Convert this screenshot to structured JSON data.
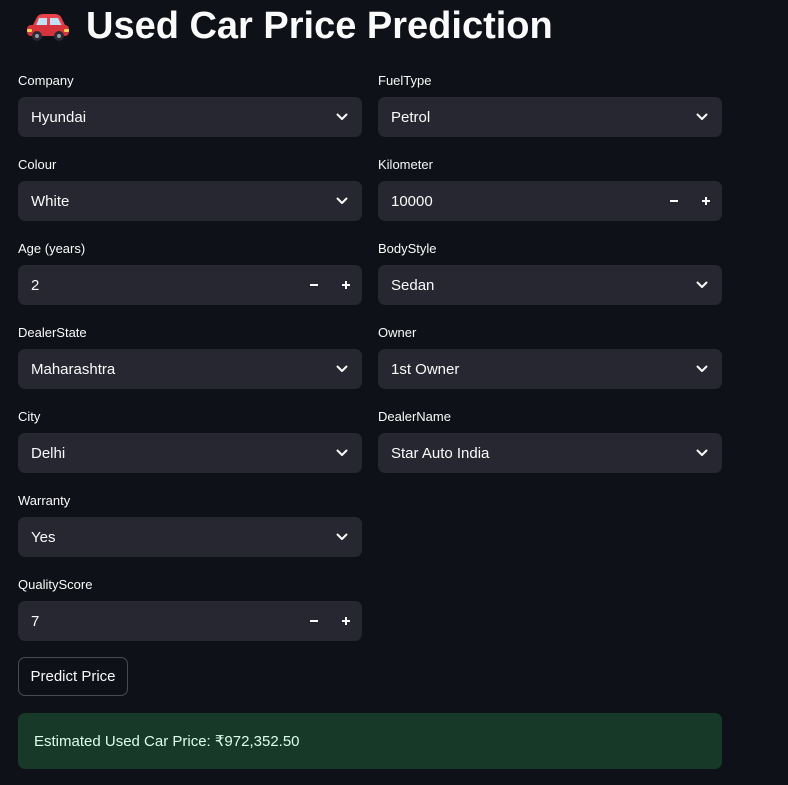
{
  "header": {
    "title": "Used Car Price Prediction",
    "icon": "car-icon"
  },
  "fields": {
    "company": {
      "label": "Company",
      "value": "Hyundai"
    },
    "fueltype": {
      "label": "FuelType",
      "value": "Petrol"
    },
    "colour": {
      "label": "Colour",
      "value": "White"
    },
    "kilometer": {
      "label": "Kilometer",
      "value": "10000"
    },
    "age": {
      "label": "Age (years)",
      "value": "2"
    },
    "bodystyle": {
      "label": "BodyStyle",
      "value": "Sedan"
    },
    "dealerstate": {
      "label": "DealerState",
      "value": "Maharashtra"
    },
    "owner": {
      "label": "Owner",
      "value": "1st Owner"
    },
    "city": {
      "label": "City",
      "value": "Delhi"
    },
    "dealername": {
      "label": "DealerName",
      "value": "Star Auto India"
    },
    "warranty": {
      "label": "Warranty",
      "value": "Yes"
    },
    "qualityscore": {
      "label": "QualityScore",
      "value": "7"
    }
  },
  "actions": {
    "predict_label": "Predict Price"
  },
  "result": {
    "text": "Estimated Used Car Price: ₹972,352.50"
  },
  "colors": {
    "background": "#0e1117",
    "input_bg": "#262730",
    "success_bg": "#173928",
    "text": "#fafafa"
  }
}
